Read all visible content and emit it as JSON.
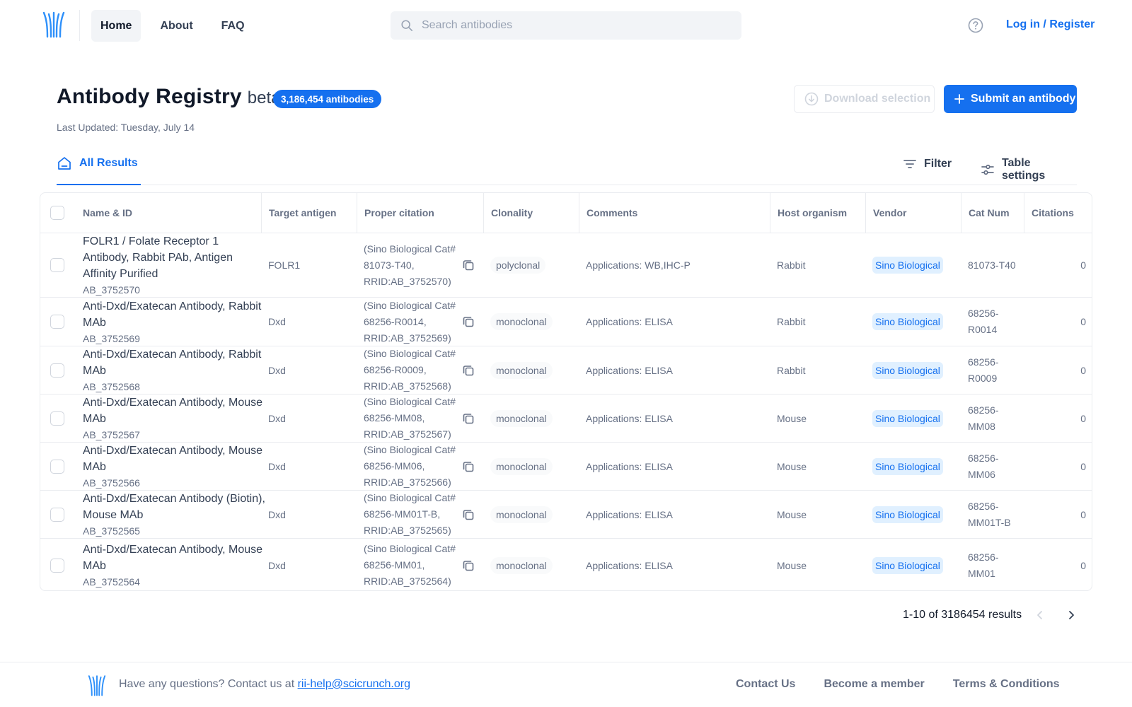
{
  "header": {
    "nav": [
      "Home",
      "About",
      "FAQ"
    ],
    "search_placeholder": "Search antibodies",
    "login_label": "Log in / Register"
  },
  "title": {
    "main": "Antibody Registry",
    "beta": "beta",
    "count_badge": "3,186,454 antibodies",
    "last_updated": "Last Updated: Tuesday, July 14"
  },
  "actions": {
    "download_label": "Download selection",
    "submit_label": "Submit an antibody"
  },
  "tabs": {
    "all_results": "All Results",
    "filter_label": "Filter",
    "settings_label": "Table settings"
  },
  "table": {
    "columns": [
      "Name & ID",
      "Target antigen",
      "Proper citation",
      "Clonality",
      "Comments",
      "Host organism",
      "Vendor",
      "Cat Num",
      "Citations"
    ],
    "rows": [
      {
        "name": "FOLR1 / Folate Receptor 1 Antibody, Rabbit PAb, Antigen Affinity Purified",
        "id": "AB_3752570",
        "target": "FOLR1",
        "citation": "(Sino Biological Cat# 81073-T40, RRID:AB_3752570)",
        "clonality": "polyclonal",
        "comments": "Applications: WB,IHC-P",
        "host": "Rabbit",
        "vendor": "Sino Biological",
        "catnum": "81073-T40",
        "citations": "0"
      },
      {
        "name": "Anti-Dxd/Exatecan Antibody, Rabbit MAb",
        "id": "AB_3752569",
        "target": "Dxd",
        "citation": "(Sino Biological Cat# 68256-R0014, RRID:AB_3752569)",
        "clonality": "monoclonal",
        "comments": "Applications: ELISA",
        "host": "Rabbit",
        "vendor": "Sino Biological",
        "catnum": "68256-R0014",
        "citations": "0"
      },
      {
        "name": "Anti-Dxd/Exatecan Antibody, Rabbit MAb",
        "id": "AB_3752568",
        "target": "Dxd",
        "citation": "(Sino Biological Cat# 68256-R0009, RRID:AB_3752568)",
        "clonality": "monoclonal",
        "comments": "Applications: ELISA",
        "host": "Rabbit",
        "vendor": "Sino Biological",
        "catnum": "68256-R0009",
        "citations": "0"
      },
      {
        "name": "Anti-Dxd/Exatecan Antibody, Mouse MAb",
        "id": "AB_3752567",
        "target": "Dxd",
        "citation": "(Sino Biological Cat# 68256-MM08, RRID:AB_3752567)",
        "clonality": "monoclonal",
        "comments": "Applications: ELISA",
        "host": "Mouse",
        "vendor": "Sino Biological",
        "catnum": "68256-MM08",
        "citations": "0"
      },
      {
        "name": "Anti-Dxd/Exatecan Antibody, Mouse MAb",
        "id": "AB_3752566",
        "target": "Dxd",
        "citation": "(Sino Biological Cat# 68256-MM06, RRID:AB_3752566)",
        "clonality": "monoclonal",
        "comments": "Applications: ELISA",
        "host": "Mouse",
        "vendor": "Sino Biological",
        "catnum": "68256-MM06",
        "citations": "0"
      },
      {
        "name": "Anti-Dxd/Exatecan Antibody (Biotin), Mouse MAb",
        "id": "AB_3752565",
        "target": "Dxd",
        "citation": "(Sino Biological Cat# 68256-MM01T-B, RRID:AB_3752565)",
        "clonality": "monoclonal",
        "comments": "Applications: ELISA",
        "host": "Mouse",
        "vendor": "Sino Biological",
        "catnum": "68256-MM01T-B",
        "citations": "0"
      },
      {
        "name": "Anti-Dxd/Exatecan Antibody, Mouse MAb",
        "id": "AB_3752564",
        "target": "Dxd",
        "citation": "(Sino Biological Cat# 68256-MM01, RRID:AB_3752564)",
        "clonality": "monoclonal",
        "comments": "Applications: ELISA",
        "host": "Mouse",
        "vendor": "Sino Biological",
        "catnum": "68256-MM01",
        "citations": "0"
      }
    ]
  },
  "pagination": {
    "summary": "1-10 of 3186454 results"
  },
  "footer": {
    "question_text": "Have any questions? Contact us at ",
    "email": "rii-help@scicrunch.org",
    "links": [
      "Contact Us",
      "Become a member",
      "Terms & Conditions"
    ]
  },
  "colors": {
    "accent": "#1570ef",
    "text_primary": "#101828",
    "text_muted": "#667085",
    "border": "#eaecf0",
    "vendor_bg": "#e0f0ff"
  }
}
